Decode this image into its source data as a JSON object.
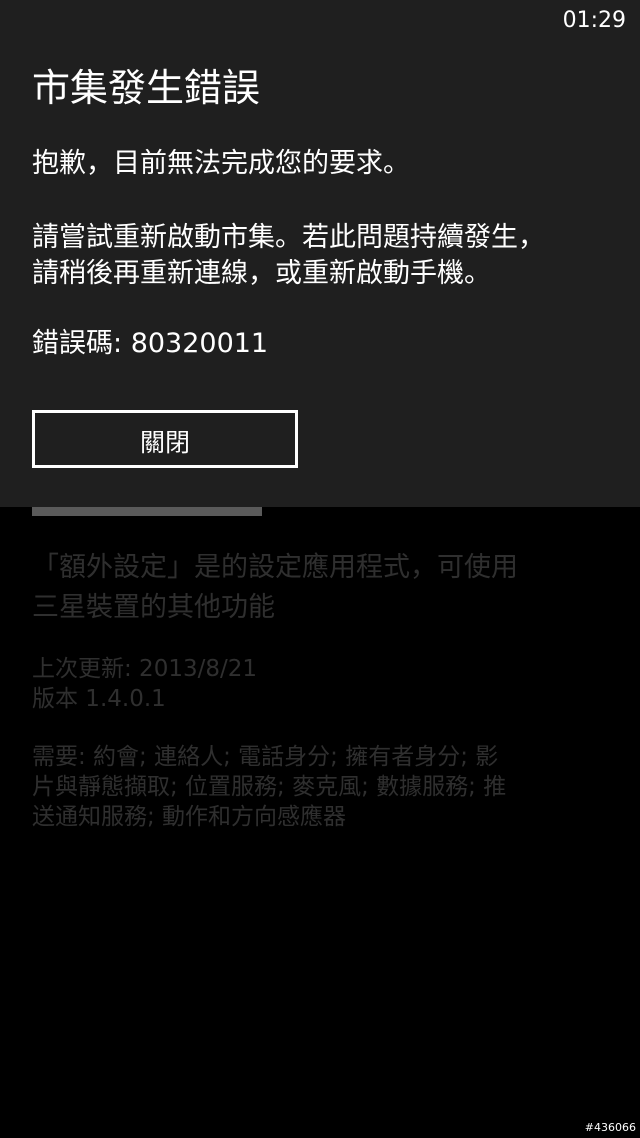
{
  "status_bar": {
    "time": "01:29"
  },
  "dialog": {
    "title": "市集發生錯誤",
    "message_line1": "抱歉，目前無法完成您的要求。",
    "message_line2": "請嘗試重新啟動市集。若此問題持續發生，",
    "message_line3": "請稍後再重新連線，或重新啟動手機。",
    "error_label": "錯誤碼: ",
    "error_code": "80320011",
    "close_button_label": "關閉"
  },
  "progress": {
    "fraction": 0.4
  },
  "background_page": {
    "description_line1": "「額外設定」是的設定應用程式，可使用",
    "description_line2": "三星裝置的其他功能",
    "last_updated": "上次更新: 2013/8/21",
    "version": "版本 1.4.0.1",
    "requires_line1": "需要: 約會; 連絡人; 電話身分; 擁有者身分; 影",
    "requires_line2": "片與靜態擷取; 位置服務; 麥克風; 數據服務; 推",
    "requires_line3": "送通知服務; 動作和方向感應器"
  },
  "watermark": "#436066",
  "colors": {
    "dialog_background": "#1f1f1f",
    "page_background": "#000000",
    "text": "#ffffff",
    "dimmed_text": "#2f2f2f",
    "progress_fill": "#5a5a5a"
  }
}
